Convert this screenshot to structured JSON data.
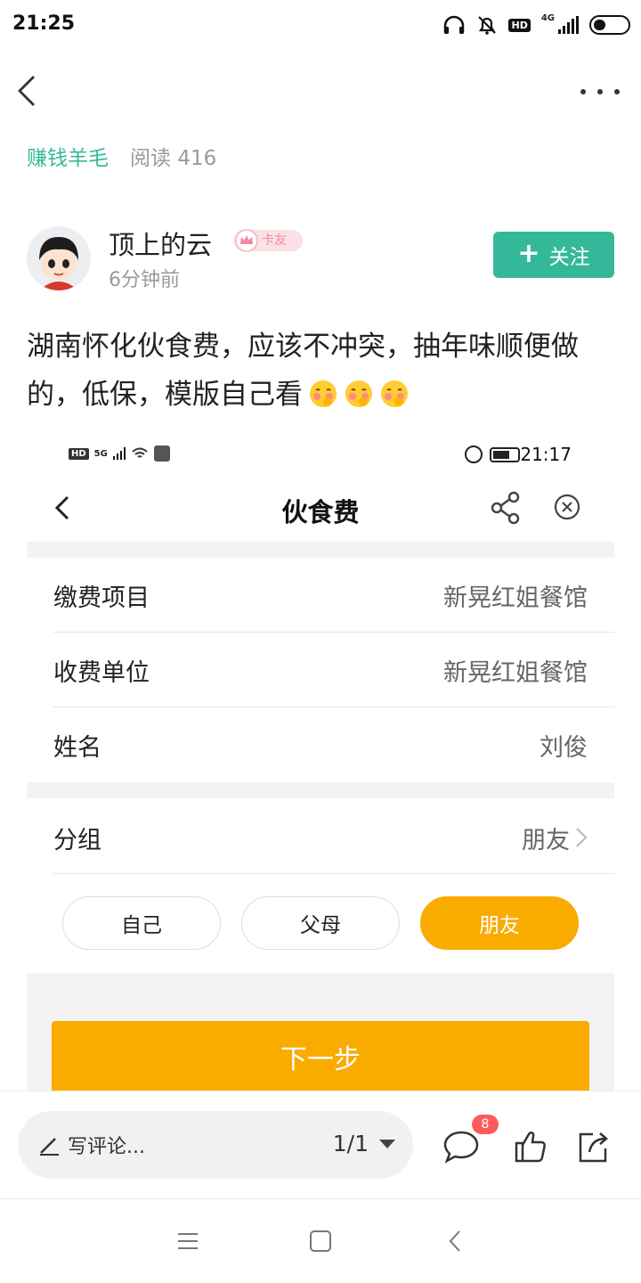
{
  "status_bar": {
    "time": "21:25",
    "network": "4G",
    "hd": "HD"
  },
  "breadcrumb": {
    "category": "赚钱羊毛",
    "read_label": "阅读",
    "read_count": "416"
  },
  "author": {
    "name": "顶上的云",
    "badge": "卡友",
    "time": "6分钟前",
    "follow_label": "关注"
  },
  "post": {
    "text": "湖南怀化伙食费，应该不冲突，抽年味顺便做的，低保，模版自己看"
  },
  "screenshot": {
    "status_time": "21:17",
    "network": "5G",
    "hd": "HD",
    "title": "伙食费",
    "fields": [
      {
        "label": "缴费项目",
        "value": "新晃红姐餐馆"
      },
      {
        "label": "收费单位",
        "value": "新晃红姐餐馆"
      },
      {
        "label": "姓名",
        "value": "刘俊"
      }
    ],
    "group": {
      "label": "分组",
      "value": "朋友"
    },
    "chips": [
      {
        "label": "自己",
        "active": false
      },
      {
        "label": "父母",
        "active": false
      },
      {
        "label": "朋友",
        "active": true
      }
    ],
    "next_label": "下一步",
    "accent_color": "#f9ab00"
  },
  "bottom_bar": {
    "comment_placeholder": "写评论...",
    "page_indicator": "1/1",
    "comment_count": "8"
  },
  "colors": {
    "brand_green": "#35b89a",
    "badge_red": "#ff5b5b"
  }
}
